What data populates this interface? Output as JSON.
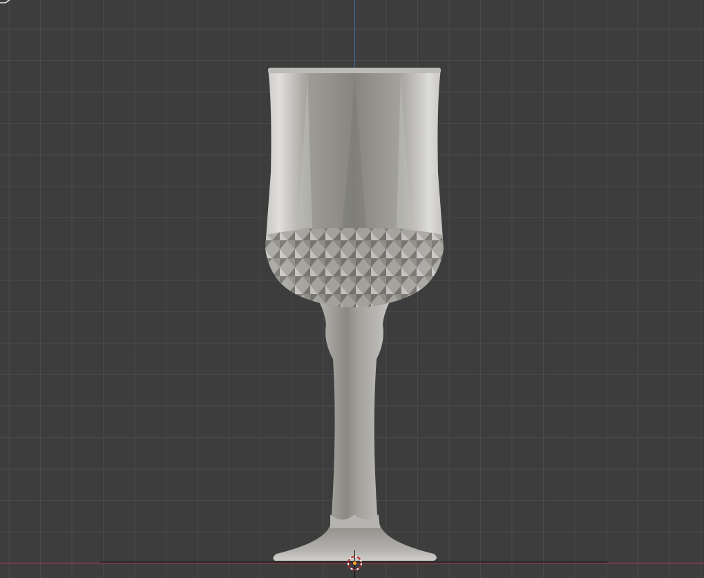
{
  "viewport": {
    "view": "front-orthographic",
    "object": "wine-glass",
    "colors": {
      "background": "#3d3d3d",
      "grid_line": "#4a4a4a",
      "x_axis": "#8a3a48",
      "z_axis": "#3f6fa8",
      "mesh_light": "#d0cfcb",
      "mesh_mid": "#9a9893",
      "mesh_dark": "#6a6965",
      "cursor_ring": "#b02a2a",
      "origin": "#f0a030"
    }
  }
}
